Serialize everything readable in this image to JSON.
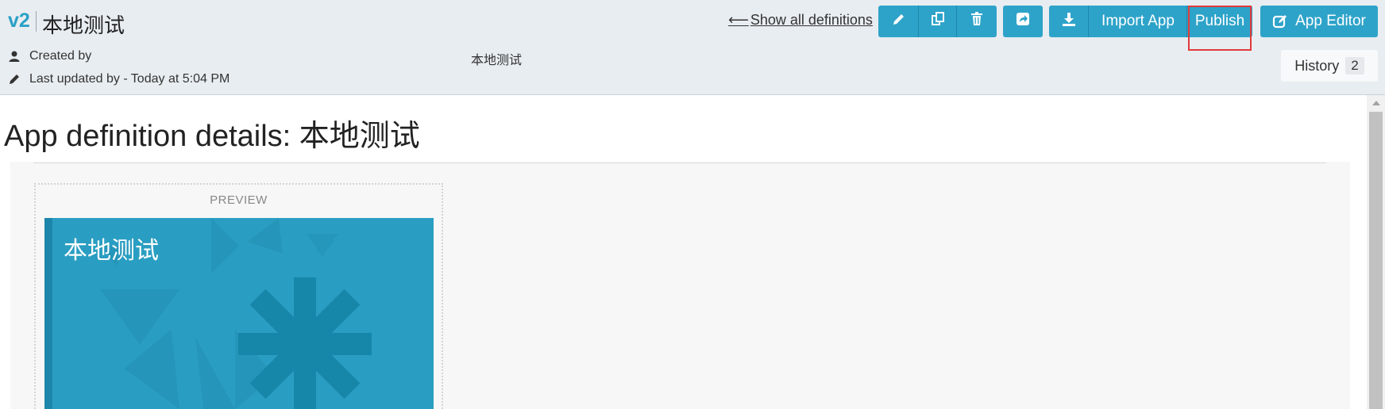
{
  "header": {
    "version": "v2",
    "app_name": "本地测试",
    "created_by": "Created by",
    "last_updated": "Last updated by - Today at 5:04 PM",
    "description": "本地测试",
    "show_all_link": "Show all definitions"
  },
  "toolbar": {
    "edit_icon": "pencil-icon",
    "copy_icon": "copy-icon",
    "delete_icon": "trash-icon",
    "share_icon": "share-icon",
    "download_icon": "download-icon",
    "import_label": "Import App",
    "publish_label": "Publish",
    "app_editor_label": "App Editor"
  },
  "history": {
    "label": "History",
    "count": "2"
  },
  "main": {
    "heading": "App definition details: 本地测试",
    "preview_label": "PREVIEW",
    "tile_title": "本地测试"
  },
  "colors": {
    "accent": "#2ea3c9",
    "header_bg": "#e8edf1",
    "tile_bg": "#2a9ec2",
    "highlight": "#e23a3a"
  }
}
